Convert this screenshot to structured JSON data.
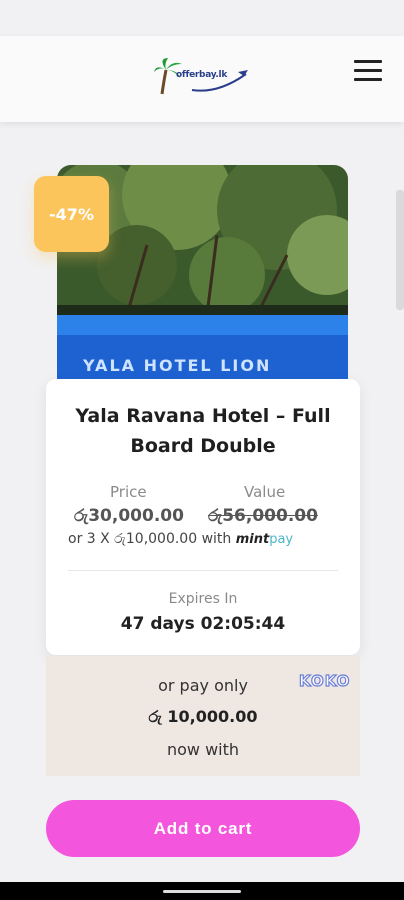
{
  "header": {
    "logo_text": "offerbay.lk",
    "logo_icon": "palm-tree-plane-logo",
    "menu_icon": "hamburger-menu-icon"
  },
  "deal": {
    "discount_badge": "-47%",
    "image_sign": "YALA HOTEL LION",
    "title": "Yala Ravana Hotel – Full Board Double",
    "price_label": "Price",
    "value_label": "Value",
    "price": "රු30,000.00",
    "value": "රු56,000.00",
    "installment_text": "or 3 X රු10,000.00 with",
    "mintpay_brand": "mint",
    "mintpay_suffix": "pay",
    "expires_label": "Expires In",
    "countdown": "47 days 02:05:44"
  },
  "koko": {
    "logo": "KOKO",
    "line1": "or pay only",
    "amount": "රු 10,000.00",
    "line3": "now with"
  },
  "actions": {
    "add_to_cart": "Add to cart"
  },
  "colors": {
    "badge": "#fcc55c",
    "cart_button": "#f455dd",
    "koko_bg": "#efe7e2",
    "pool": "#1e62d2"
  }
}
